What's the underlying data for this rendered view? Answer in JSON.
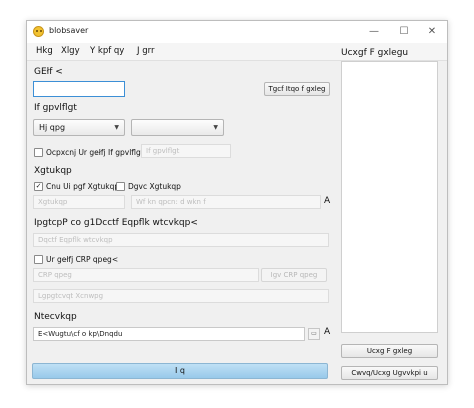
{
  "window": {
    "title": "blobsaver",
    "controls": {
      "minimize": "—",
      "maximize": "☐",
      "close": "✕"
    }
  },
  "menu": [
    "Hkg",
    "Xlgy",
    "Y kpf qy",
    "J grr"
  ],
  "ecid": {
    "label": "GEłf <",
    "value": "",
    "read_button": "Tgcf Itqo f gxleg"
  },
  "identifier": {
    "label": "If gpvlflgt",
    "device_type": "Hj qpg",
    "device_model": ""
  },
  "identifier_check": {
    "checked": false,
    "label": "Ocpxcnj Ur gełfj If gpvlflgt<",
    "input_placeholder": "If gpvlflgt"
  },
  "versions": {
    "label": "Xgtukqp",
    "current_checked": true,
    "current_label": "Cnu Ui pgf Xgtukqpu",
    "beta_checked": false,
    "beta_label": "Dgvc Xgtukqp",
    "version_placeholder": "Xgtukqp",
    "build_placeholder": "Wf kn qpcn: d wkn f",
    "side_label": "A"
  },
  "ipsw": {
    "label": "IpgtcpP co g1Dcctf Eqpflk wtcvkqp<",
    "field_placeholder": "Dqctf Eqpflk wtcvkqp",
    "apnonce_checked": false,
    "apnonce_label": "Ur gełfj CRP qpeg<",
    "apnonce_placeholder": "CRP qpeg",
    "apnonce_button": "Igv CRP qpeg",
    "generator_placeholder": "Lgpgtcvqt Xcnwpg"
  },
  "savepath": {
    "label": "Ntecvkqp",
    "value": "E<Wugtu\\cf o kp\\Dnqdu",
    "side_label": "A"
  },
  "go_button": "I q",
  "saved_devices": {
    "title": "Ucxgf F gxlegu",
    "save_button": "Ucxg F gxleg",
    "clear_button": "Cwvq/Ucxg Ugvvkpi u"
  }
}
